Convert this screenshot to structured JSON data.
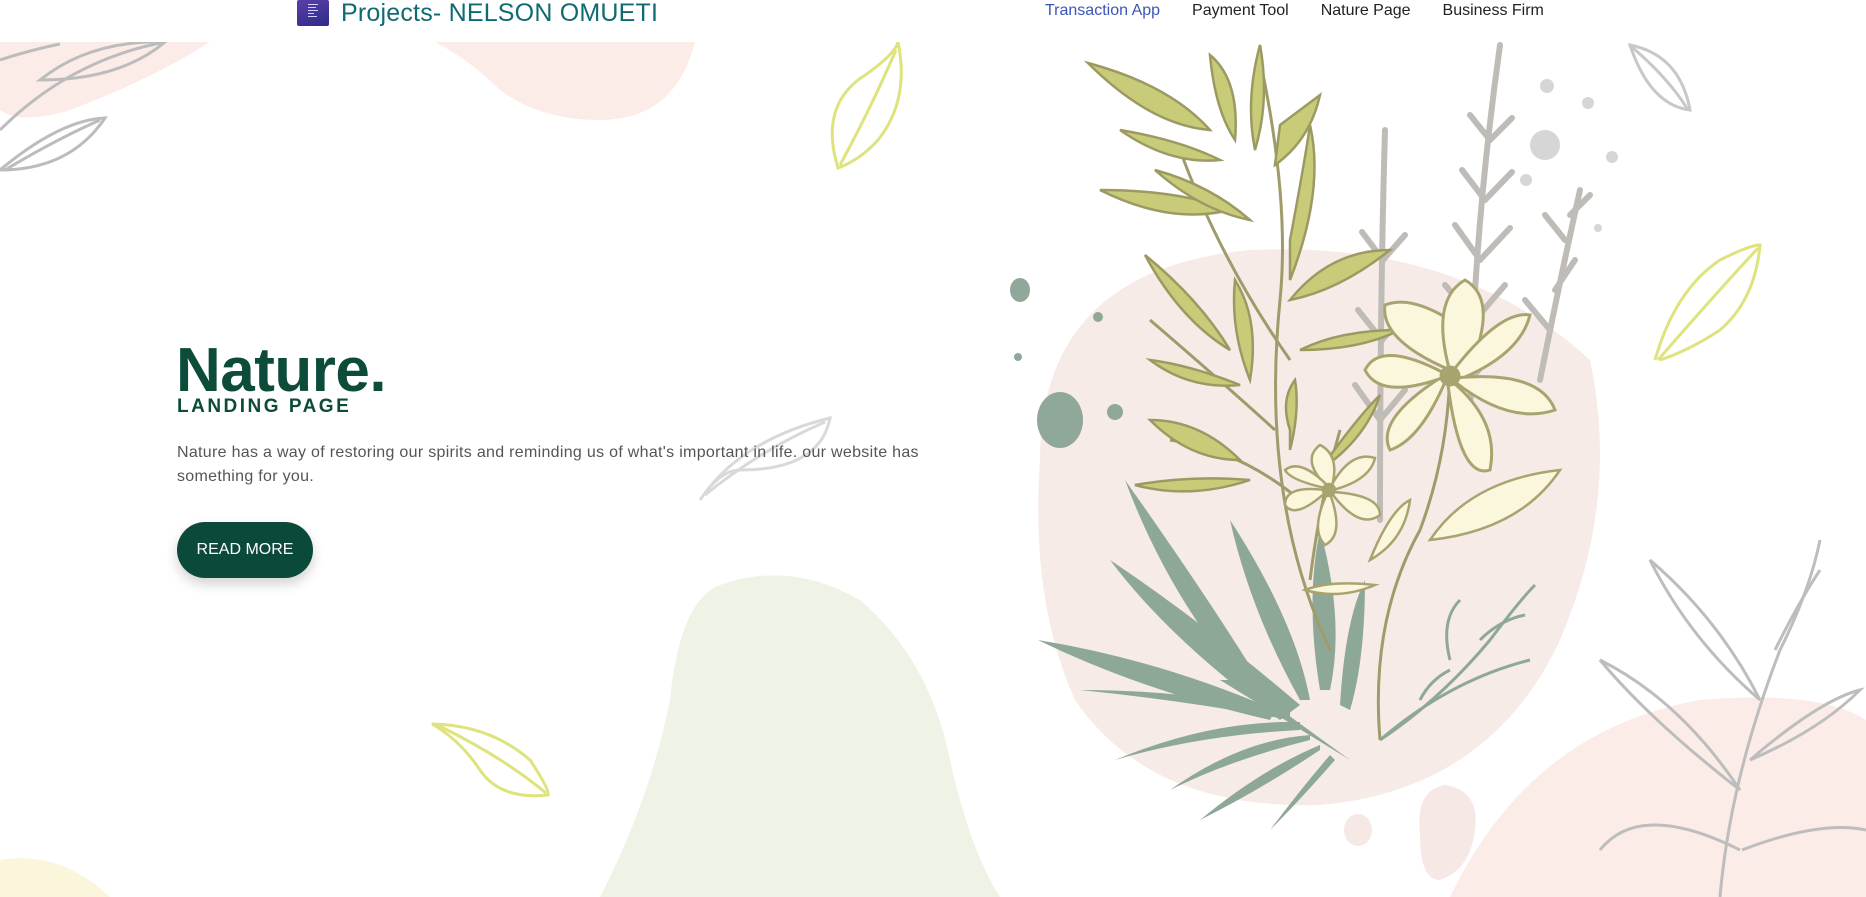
{
  "navbar": {
    "brand_title": "Projects- NELSON OMUETI",
    "links": [
      {
        "label": "Transaction App",
        "active": true
      },
      {
        "label": "Payment Tool",
        "active": false
      },
      {
        "label": "Nature Page",
        "active": false
      },
      {
        "label": "Business Firm",
        "active": false
      }
    ]
  },
  "hero": {
    "title": "Nature.",
    "subtitle": "LANDING PAGE",
    "description": "Nature has a way of restoring our spirits and reminding us of what's important in life. our website has something for you.",
    "button_label": "READ MORE"
  },
  "colors": {
    "brand_teal": "#0f6b72",
    "active_link": "#3b55b5",
    "dark_green": "#0d4b3a",
    "sage": "#8fa89a",
    "olive": "#c8cc78",
    "blush": "#f6e8e4",
    "pale_green": "#eef3e6",
    "lime_leaf": "#e2e58a",
    "grey_leaf": "#bdbdbd",
    "cream_flower": "#fbf7dc"
  },
  "icons": {
    "brand_logo": "brand-logo-icon"
  }
}
